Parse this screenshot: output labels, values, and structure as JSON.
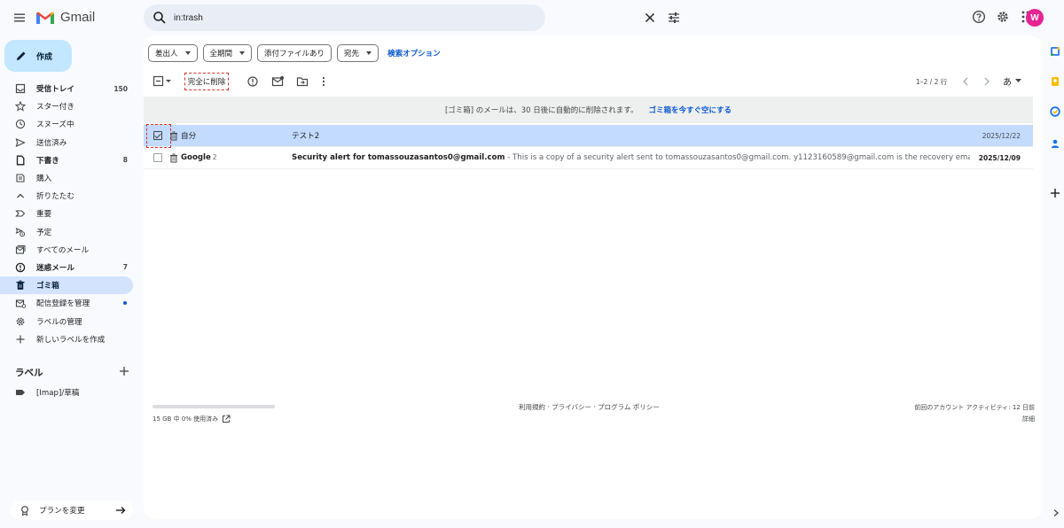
{
  "app": {
    "name": "Gmail",
    "avatar_letter": "W",
    "accent": "#c2e7ff",
    "highlight": "#d93025"
  },
  "search": {
    "value": "in:trash"
  },
  "compose": {
    "label": "作成"
  },
  "nav": [
    {
      "id": "inbox",
      "label": "受信トレイ",
      "count": "150",
      "bold": true,
      "icon": "inbox-icon"
    },
    {
      "id": "starred",
      "label": "スター付き",
      "count": "",
      "icon": "star-icon"
    },
    {
      "id": "snoozed",
      "label": "スヌーズ中",
      "count": "",
      "icon": "clock-icon"
    },
    {
      "id": "sent",
      "label": "送信済み",
      "count": "",
      "icon": "send-icon"
    },
    {
      "id": "drafts",
      "label": "下書き",
      "count": "8",
      "bold": true,
      "icon": "draft-icon"
    },
    {
      "id": "purchases",
      "label": "購入",
      "count": "",
      "icon": "purchase-icon"
    },
    {
      "id": "less",
      "label": "折りたたむ",
      "count": "",
      "icon": "chevron-up-icon"
    },
    {
      "id": "important",
      "label": "重要",
      "count": "",
      "icon": "important-icon"
    },
    {
      "id": "scheduled",
      "label": "予定",
      "count": "",
      "icon": "scheduled-icon"
    },
    {
      "id": "allmail",
      "label": "すべてのメール",
      "count": "",
      "icon": "all-mail-icon"
    },
    {
      "id": "spam",
      "label": "迷惑メール",
      "count": "7",
      "bold": true,
      "icon": "spam-icon"
    },
    {
      "id": "trash",
      "label": "ゴミ箱",
      "count": "",
      "active": true,
      "icon": "trash-icon"
    },
    {
      "id": "subscriptions",
      "label": "配信登録を管理",
      "count": "",
      "dot": true,
      "icon": "subscriptions-icon"
    },
    {
      "id": "manage-labels",
      "label": "ラベルの管理",
      "count": "",
      "icon": "gear-icon"
    },
    {
      "id": "new-label",
      "label": "新しいラベルを作成",
      "count": "",
      "icon": "plus-icon"
    }
  ],
  "labels": {
    "header": "ラベル",
    "items": [
      {
        "label": "[Imap]/草稿"
      }
    ]
  },
  "plan": {
    "label": "プランを変更"
  },
  "filters": {
    "chips": [
      "差出人",
      "全期間",
      "添付ファイルあり",
      "宛先"
    ],
    "advanced": "検索オプション"
  },
  "toolbar": {
    "delete_forever": "完全に削除",
    "pager": "1–2 / 2 行",
    "lang": "あ"
  },
  "banner": {
    "text": "[ゴミ箱] のメールは、30 日後に自動的に削除されます。",
    "action": "ゴミ箱を今すぐ空にする"
  },
  "emails": [
    {
      "sender": "自分",
      "sender_count": "",
      "subject": "テスト2",
      "snippet": "",
      "date": "2025/12/22",
      "selected": true,
      "unread": false
    },
    {
      "sender": "Google",
      "sender_count": "2",
      "subject": "Security alert for tomassouzasantos0@gmail.com",
      "snippet": " - This is a copy of a security alert sent to tomassouzasantos0@gmail.com. y1123160589@gmail.com is the recovery email for this acco...",
      "date": "2025/12/09",
      "selected": false,
      "unread": true
    }
  ],
  "footer": {
    "storage": "15 GB 中 0% 使用済み",
    "storage_fraction": 0.0,
    "links": "利用規約 · プライバシー · プログラム ポリシー",
    "activity": "前回のアカウント アクティビティ: 12 日前",
    "details": "詳細"
  }
}
